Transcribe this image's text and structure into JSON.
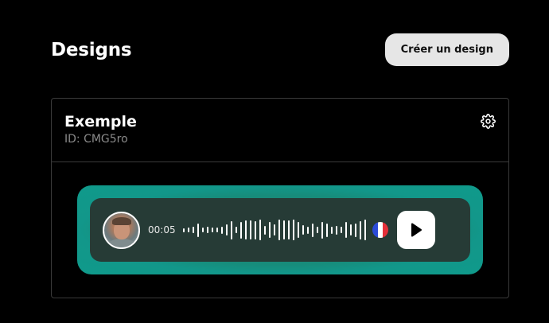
{
  "header": {
    "title": "Designs",
    "create_button_label": "Créer un design"
  },
  "card": {
    "title": "Exemple",
    "id_text": "ID: CMG5ro",
    "settings_icon": "gear-icon"
  },
  "player": {
    "duration": "00:05",
    "avatar_icon": "avatar",
    "flag_icon": "france-flag-icon",
    "play_icon": "play-icon",
    "waveform_levels": [
      0.15,
      0.2,
      0.25,
      0.55,
      0.2,
      0.25,
      0.2,
      0.2,
      0.3,
      0.45,
      0.75,
      0.25,
      0.7,
      0.8,
      0.8,
      0.75,
      0.85,
      0.35,
      0.65,
      0.45,
      0.85,
      0.8,
      0.8,
      0.85,
      0.65,
      0.4,
      0.3,
      0.55,
      0.25,
      0.7,
      0.55,
      0.3,
      0.35,
      0.25,
      0.65,
      0.45,
      0.55,
      0.75,
      0.85
    ],
    "colors": {
      "panel": "#263b36",
      "outer": "#12978a",
      "flag_blue": "#2b4bd8",
      "flag_white": "#ffffff",
      "flag_red": "#e5303a"
    }
  }
}
